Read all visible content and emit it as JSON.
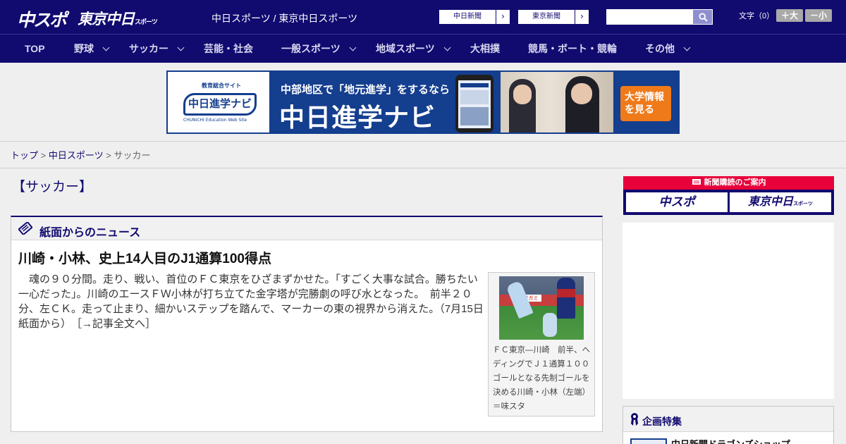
{
  "header": {
    "logo_chuspo": "中スポ",
    "logo_tokyo": "東京中日",
    "logo_tokyo_small": "スポーツ",
    "site_title": "中日スポーツ / 東京中日スポーツ",
    "paper_links": [
      "中日新聞",
      "東京新聞"
    ],
    "search_placeholder": "",
    "font_size_label": "文字（0）",
    "font_larger": "＋大",
    "font_smaller": "－小"
  },
  "nav": {
    "items": [
      {
        "label": "TOP",
        "dropdown": false
      },
      {
        "label": "野球",
        "dropdown": true
      },
      {
        "label": "サッカー",
        "dropdown": true
      },
      {
        "label": "芸能・社会",
        "dropdown": false
      },
      {
        "label": "一般スポーツ",
        "dropdown": true
      },
      {
        "label": "地域スポーツ",
        "dropdown": true
      },
      {
        "label": "大相撲",
        "dropdown": false
      },
      {
        "label": "競馬・ボート・競輪",
        "dropdown": false
      },
      {
        "label": "その他",
        "dropdown": true
      }
    ]
  },
  "banner": {
    "logo_top": "教育総合サイト",
    "logo_main": "中日進学ナビ",
    "logo_sub": "CHUNICHI Education Web Site",
    "catch": "中部地区で「地元進学」をするなら",
    "title": "中日進学ナビ",
    "cta_line1": "大学情報",
    "cta_line2": "を見る"
  },
  "breadcrumb": {
    "items": [
      "トップ",
      "中日スポーツ"
    ],
    "separator": ">",
    "current": "サッカー"
  },
  "section_title": "【サッカー】",
  "news": {
    "box_title": "紙面からのニュース",
    "headline": "川崎・小林、史上14人目のJ1通算100得点",
    "body": "魂の９０分間。走り、戦い、首位のＦＣ東京をひざまずかせた。「すごく大事な試合。勝ちたい一心だった」。川崎のエースＦＷ小林が打ち立てた金字塔が完勝劇の呼び水となった。　前半２０分、左ＣＫ。走って止まり、細かいステップを踏んで、マーカーの東の視界から消えた。（7月15日 紙面から）",
    "more_link": "［→記事全文へ］",
    "photo_ad_text": "サガミ",
    "photo_caption": "ＦＣ東京―川崎　前半、ヘディングでＪ１通算１００ゴールとなる先制ゴールを決める川崎・小林（左端）＝味スタ"
  },
  "sidebar": {
    "subscribe_title": "新聞購読のご案内",
    "subscribe_buttons": [
      "中スポ",
      "東京中日"
    ],
    "subscribe_small": "スポーツ",
    "kikaku_title": "企画特集",
    "kikaku_first_item": "中日新聞ドラゴンズショップ"
  },
  "colors": {
    "brand_navy": "#110a6f",
    "subscribe_red": "#e8003a",
    "banner_blue": "#143e8e",
    "banner_orange": "#ef7a1a"
  }
}
